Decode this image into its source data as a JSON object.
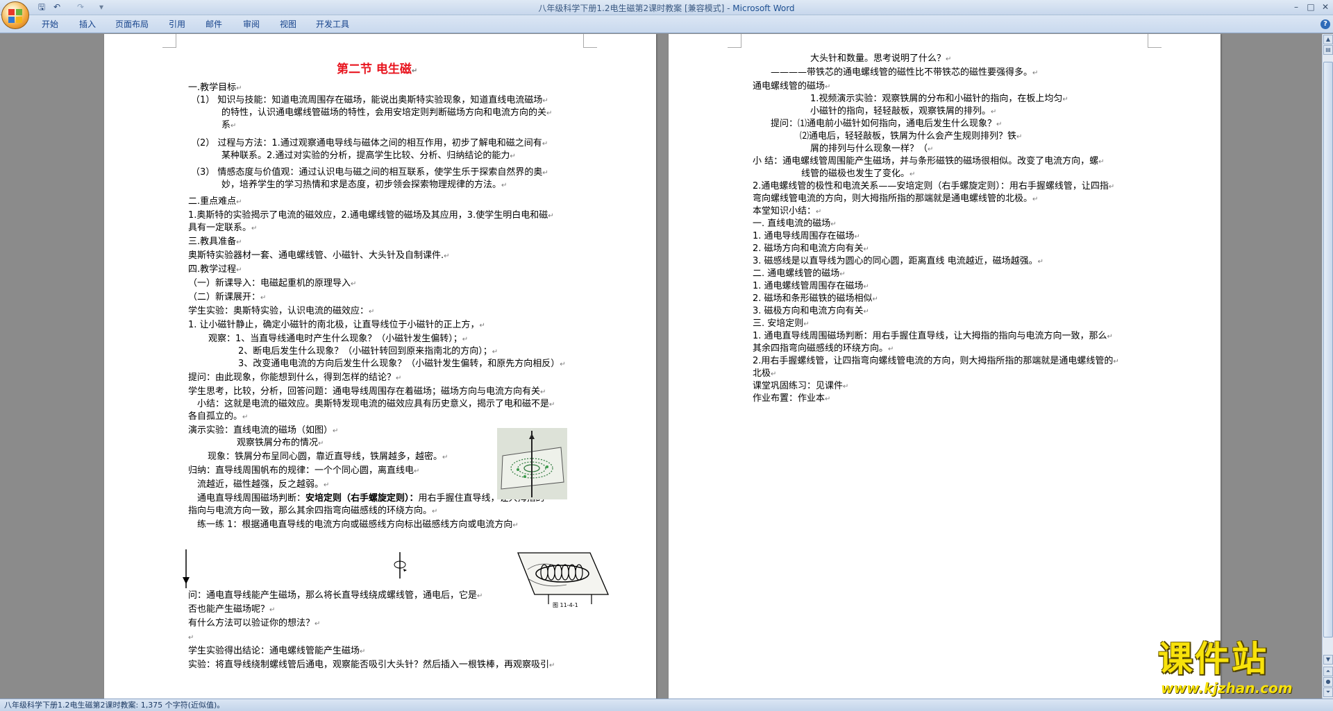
{
  "window": {
    "doc_name": "八年级科学下册1.2电生磁第2课时教案 [兼容模式] - ",
    "app_name": "Microsoft Word",
    "help": "?"
  },
  "quick_access": {
    "save": "🖫",
    "undo": "↶",
    "redo": "↷",
    "customize": "▾"
  },
  "window_controls": {
    "minimize": "–",
    "maximize": "□",
    "close": "✕"
  },
  "ribbon_tabs": [
    "开始",
    "插入",
    "页面布局",
    "引用",
    "邮件",
    "审阅",
    "视图",
    "开发工具"
  ],
  "status_bar": {
    "text": "八年级科学下册1.2电生磁第2课时教案: 1,375 个字符(近似值)。"
  },
  "watermark": {
    "text": "课件站",
    "url": "www.kjzhan.com"
  },
  "page_left": {
    "title": "第二节  电生磁",
    "lines": [
      "一.教学目标",
      "（1）      知识与技能：知道电流周围存在磁场，能说出奥斯特实验现象，知道直线电流磁场",
      "的特性，认识通电螺线管磁场的特性，会用安培定则判断磁场方向和电流方向的关",
      "系",
      "（2）      过程与方法：1.通过观察通电导线与磁体之间的相互作用，初步了解电和磁之间有",
      "某种联系。2.通过对实验的分析，提高学生比较、分析、归纳结论的能力",
      "（3）      情感态度与价值观：通过认识电与磁之间的相互联系，使学生乐于探索自然界的奥",
      "妙，培养学生的学习热情和求是态度，初步领会探索物理规律的方法。",
      "二.重点难点",
      "1.奥斯特的实验揭示了电流的磁效应，2.通电螺线管的磁场及其应用，3.使学生明白电和磁",
      "具有一定联系。",
      "三.教具准备",
      "奥斯特实验器材一套、通电螺线管、小磁针、大头针及自制课件.",
      "四.教学过程",
      "（一）新课导入：电磁起重机的原理导入",
      "（二）新课展开：",
      "学生实验：奥斯特实验，认识电流的磁效应：",
      "1.   让小磁针静止，确定小磁针的南北极，让直导线位于小磁针的正上方，",
      "观察：1、当直导线通电时产生什么现象？（小磁针发生偏转）；",
      "2、断电后发生什么现象？（小磁针转回到原来指南北的方向）；",
      "3、改变通电电流的方向后发生什么现象？（小磁针发生偏转，和原先方向相反）",
      "提问：由此现象，你能想到什么，得到怎样的结论？",
      "学生思考，比较，分析，回答问题：通电导线周围存在着磁场；磁场方向与电流方向有关",
      "小结：这就是电流的磁效应。奥斯特发现电流的磁效应具有历史意义，揭示了电和磁不是",
      "各自孤立的。",
      "演示实验：直线电流的磁场（如图）",
      "观察铁屑分布的情况",
      "现象：铁屑分布呈同心圆，靠近直导线，铁屑越多，越密。",
      "归纳：直导线周围帆布的规律：一个个同心圆，离直线电",
      "流越近，磁性越强，反之越弱。",
      "通电直导线周围磁场判断：",
      "安培定则（右手螺旋定则）：",
      "用右手握住直导线，让大拇指的",
      "指向与电流方向一致，那么其余四指弯向磁感线的环绕方向。",
      "练一练 1：根据通电直导线的电流方向或磁感线方向标出磁感线方向或电流方向",
      "问：通电直导线能产生磁场，那么将长直导线绕成螺线管，通电后，它是",
      "否也能产生磁场呢？",
      "有什么方法可以验证你的想法？",
      "学生实验得出结论：通电螺线管能产生磁场",
      "实验：将直导线绕制螺线管后通电，观察能否吸引大头针？然后插入一根铁棒，再观察吸引"
    ],
    "figure_caption": "图    11-4-1"
  },
  "page_right": {
    "lines": [
      "大头针和数量。思考说明了什么？",
      "————带铁芯的通电螺线管的磁性比不带铁芯的磁性要强得多。",
      "通电螺线管的磁场",
      "1.视频演示实验：观察铁屑的分布和小磁针的指向，在板上均匀",
      "小磁针的指向，轻轻敲板，观察铁屑的排列。",
      "提问：⑴通电前小磁针如何指向，通电后发生什么现象？",
      "⑵通电后，轻轻敲板，铁屑为什么会产生规则排列？铁",
      "屑的排列与什么现象一样？（",
      "小      结：通电螺线管周围能产生磁场，并与条形磁铁的磁场很相似。改变了电流方向，螺",
      "线管的磁极也发生了变化。",
      "2.通电螺线管的极性和电流关系——安培定则（右手螺旋定则）：用右手握螺线管，让四指",
      "弯向螺线管电流的方向，则大拇指所指的那端就是通电螺线管的北极。",
      "本堂知识小结：",
      "一.   直线电流的磁场",
      "1. 通电导线周围存在磁场",
      "2. 磁场方向和电流方向有关",
      "3. 磁感线是以直导线为圆心的同心圆，距离直线      电流越近，磁场越强。",
      "二.   通电螺线管的磁场",
      "1. 通电螺线管周围存在磁场",
      "2. 磁场和条形磁铁的磁场相似",
      "3. 磁极方向和电流方向有关",
      "三.   安培定则",
      "1. 通电直导线周围磁场判断：用右手握住直导线，让大拇指的指向与电流方向一致，那么",
      "其余四指弯向磁感线的环绕方向。",
      "2.用右手握螺线管，让四指弯向螺线管电流的方向，则大拇指所指的那端就是通电螺线管的",
      "北极",
      "课堂巩固练习：见课件",
      "作业布置：作业本"
    ]
  }
}
